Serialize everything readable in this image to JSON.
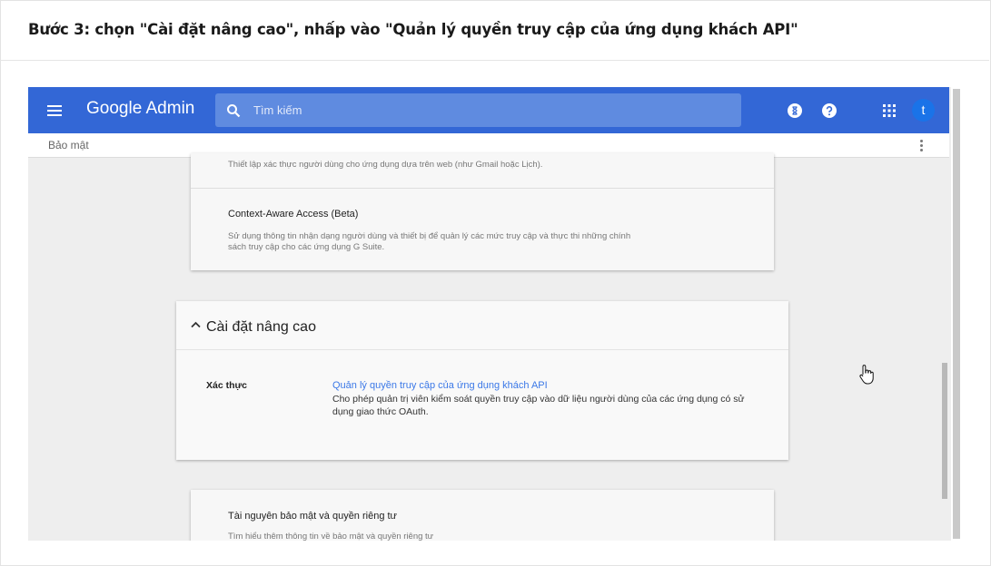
{
  "step": {
    "title": "Bước 3: chọn \"Cài đặt nâng cao\", nhấp vào \"Quản lý quyền truy cập của ứng dụng khách API\""
  },
  "topbar": {
    "logo": "Google Admin",
    "search_placeholder": "Tìm kiếm",
    "avatar_letter": "t",
    "icons": [
      "menu-icon",
      "search-icon",
      "hourglass-icon",
      "help-icon",
      "apps-grid-icon"
    ]
  },
  "breadcrumb": "Bảo mật",
  "card1": {
    "top_desc": "Thiết lập xác thực người dùng cho ứng dụng dựa trên web (như Gmail hoặc Lịch).",
    "title": "Context-Aware Access (Beta)",
    "desc_line1": "Sử dụng thông tin nhận dạng người dùng và thiết bị để quản lý các mức truy cập và thực thi những chính",
    "desc_line2": "sách truy cập cho các ứng dụng G Suite."
  },
  "advanced": {
    "title": "Cài đặt nâng cao",
    "row_label": "Xác thực",
    "link": "Quản lý quyền truy cập của ứng dụng khách API",
    "link_desc": "Cho phép quản trị viên kiểm soát quyền truy cập vào dữ liệu người dùng của các ứng dụng có sử dụng giao thức OAuth."
  },
  "card3": {
    "title": "Tài nguyên bảo mật và quyền riêng tư",
    "desc": "Tìm hiểu thêm thông tin về bảo mật và quyền riêng tư"
  },
  "colors": {
    "header_blue": "#3367d6",
    "link_blue": "#3b78e7"
  }
}
